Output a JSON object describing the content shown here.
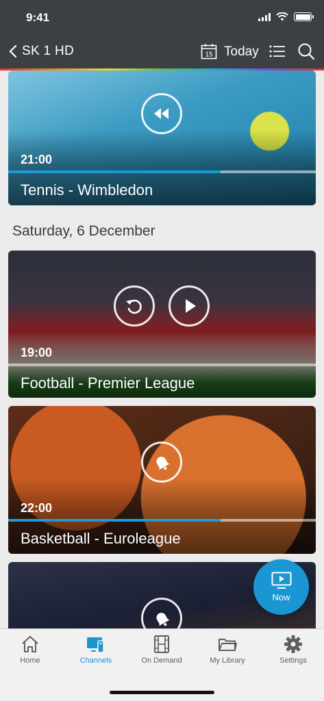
{
  "status": {
    "time": "9:41"
  },
  "nav": {
    "back_icon": "chevron-left-icon",
    "channel_title": "SK 1 HD",
    "calendar_day": "15",
    "today_label": "Today"
  },
  "programs": [
    {
      "time": "21:00",
      "title": "Tennis - Wimbledon",
      "action_icon": "rewind-icon",
      "progress": 0.69
    },
    {
      "time": "19:00",
      "title": "Football - Premier League",
      "action_icons": [
        "replay-icon",
        "play-icon"
      ],
      "progress": 0
    },
    {
      "time": "22:00",
      "title": "Basketball - Euroleague",
      "action_icon": "bell-icon",
      "progress": 0.69
    },
    {
      "action_icon": "bell-icon"
    }
  ],
  "date_heading": "Saturday, 6 December",
  "now_button": {
    "label": "Now",
    "icon": "tv-play-icon"
  },
  "tabs": [
    {
      "label": "Home",
      "icon": "home-icon",
      "active": false
    },
    {
      "label": "Channels",
      "icon": "tv-remote-icon",
      "active": true
    },
    {
      "label": "On Demand",
      "icon": "film-icon",
      "active": false
    },
    {
      "label": "My Library",
      "icon": "folder-icon",
      "active": false
    },
    {
      "label": "Settings",
      "icon": "gear-icon",
      "active": false
    }
  ],
  "colors": {
    "accent": "#1a96d3",
    "header": "#3c4043"
  }
}
